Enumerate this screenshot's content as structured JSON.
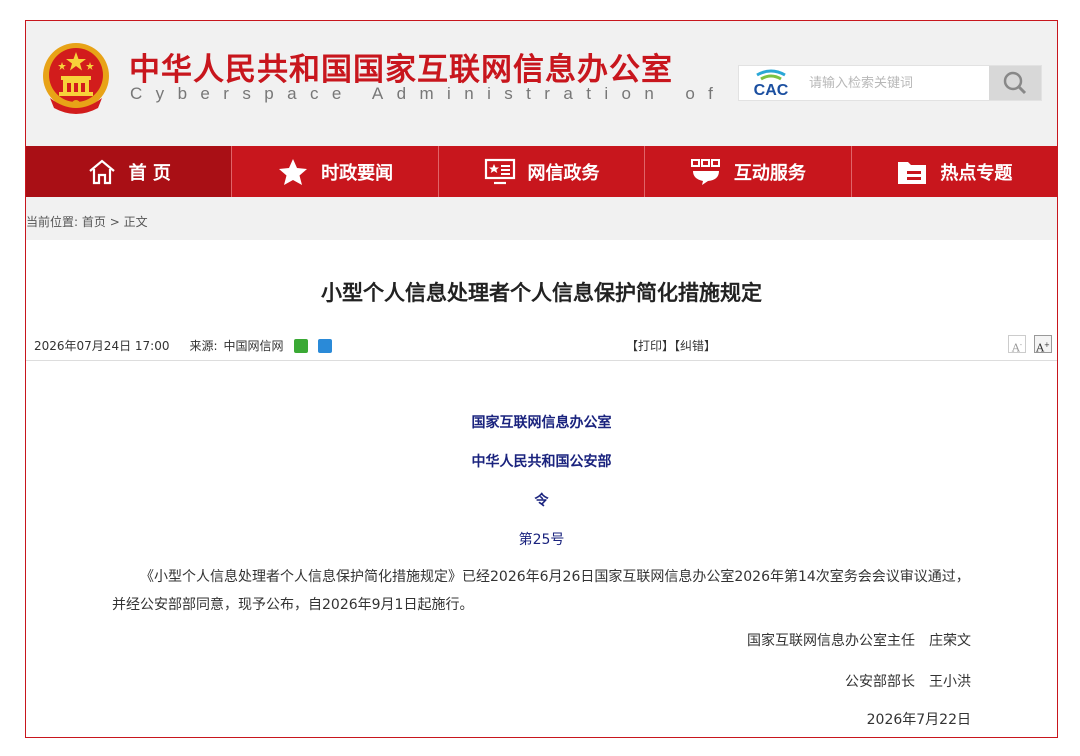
{
  "header": {
    "title": "中华人民共和国国家互联网信息办公室",
    "subtitle": "Cyberspace Administration of China",
    "emblem_icon": "national-emblem-icon",
    "logo_text": "CAC",
    "search_placeholder": "请输入检索关键词",
    "search_icon": "search-icon"
  },
  "nav": {
    "items": [
      {
        "label": "首 页",
        "icon": "home-icon"
      },
      {
        "label": "时政要闻",
        "icon": "star-icon"
      },
      {
        "label": "网信政务",
        "icon": "monitor-icon"
      },
      {
        "label": "互动服务",
        "icon": "chat-icon"
      },
      {
        "label": "热点专题",
        "icon": "folder-icon"
      }
    ]
  },
  "breadcrumb": {
    "prefix": "当前位置:",
    "home": "首页",
    "sep": ">",
    "current": "正文"
  },
  "article": {
    "title": "小型个人信息处理者个人信息保护简化措施规定",
    "date": "2026年07月24日 17:00",
    "source_label": "来源:",
    "source": "中国网信网",
    "print": "【打印】",
    "correct": "【纠错】",
    "font_smaller": "A",
    "font_larger": "A",
    "issuer1": "国家互联网信息办公室",
    "issuer2": "中华人民共和国公安部",
    "order": "令",
    "number": "第25号",
    "body": "《小型个人信息处理者个人信息保护简化措施规定》已经2026年6月26日国家互联网信息办公室2026年第14次室务会会议审议通过，并经公安部部同意，现予公布，自2026年9月1日起施行。",
    "sign1": "国家互联网信息办公室主任　庄荣文",
    "sign2": "公安部部长　王小洪",
    "sign_date": "2026年7月22日"
  },
  "colors": {
    "brand_red": "#c8161d",
    "nav_active": "#a90f15",
    "header_bg": "#f1f1f1",
    "heading_blue": "#1a237e"
  }
}
